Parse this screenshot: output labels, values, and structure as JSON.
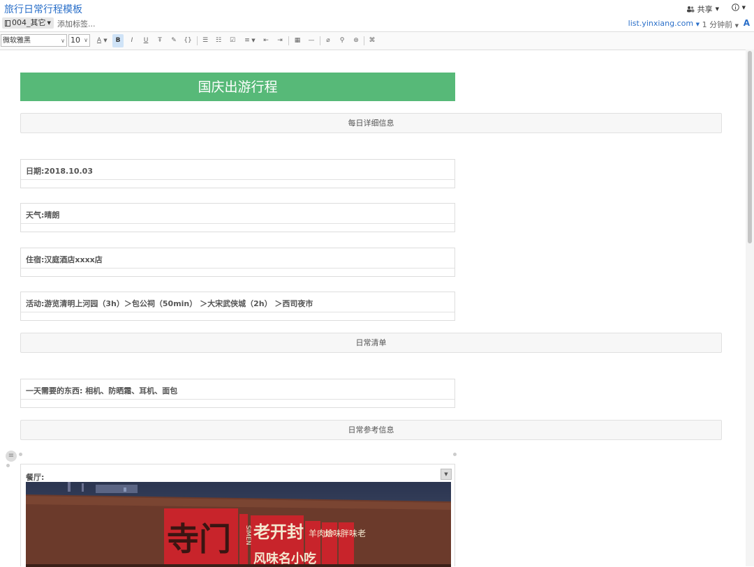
{
  "window": {
    "note_title": "旅行日常行程模板",
    "share_label": "共享",
    "notebook": "004_其它",
    "add_tag": "添加标签...",
    "source": "list.yinxiang.com",
    "time_ago": "1 分钟前",
    "font_a": "A"
  },
  "toolbar": {
    "font_family": "微软雅黑",
    "font_size": "10",
    "buttons": [
      "text-color",
      "bold",
      "italic",
      "underline",
      "strikethrough",
      "highlight",
      "code",
      "bullet-list",
      "numbered-list",
      "checkbox",
      "align",
      "outdent",
      "indent",
      "table",
      "horizontal-rule",
      "attachment",
      "link",
      "encrypt",
      "shortcut"
    ]
  },
  "doc": {
    "banner": "国庆出游行程",
    "section1": "每日详细信息",
    "date": "日期:2018.10.03",
    "weather": "天气:晴朗",
    "lodging": "住宿:汉庭酒店xxxx店",
    "activity": "活动:游览清明上河园（3h）＞包公祠（50min） ＞大宋武侠城（2h） ＞西司夜市",
    "section2": "日常清单",
    "checklist": "一天需要的东西: 相机、防晒霜、耳机、面包",
    "section3": "日常参考信息",
    "restaurant_label": "餐厅:",
    "photo_sign_main": "寺门",
    "photo_sign_brand": "老开封",
    "photo_sign_sub": "风味名小吃",
    "photo_sign_vertical": "SIMEN",
    "photo_sign_small": "羊肉炒",
    "photo_sign_small2": "烩味",
    "photo_sign_small3": "胖味老"
  },
  "colors": {
    "accent": "#2a6fc9",
    "banner": "#57b978"
  }
}
